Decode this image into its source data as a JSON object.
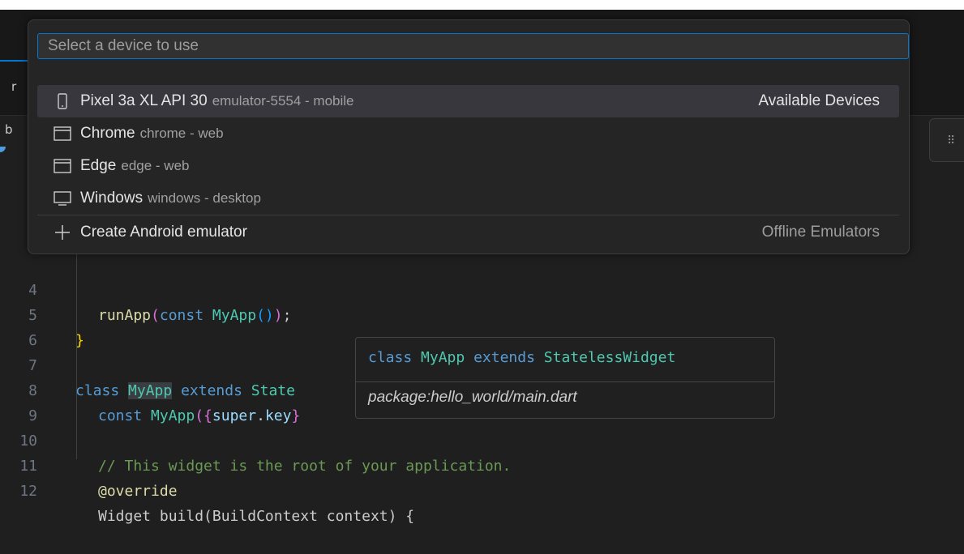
{
  "quick_pick": {
    "placeholder": "Select a device to use",
    "items": [
      {
        "icon": "phone-icon",
        "label": "Pixel 3a XL API 30",
        "description": "emulator-5554 - mobile",
        "group": "Available Devices",
        "selected": true
      },
      {
        "icon": "browser-window-icon",
        "label": "Chrome",
        "description": "chrome - web",
        "group": ""
      },
      {
        "icon": "browser-window-icon",
        "label": "Edge",
        "description": "edge - web",
        "group": ""
      },
      {
        "icon": "monitor-icon",
        "label": "Windows",
        "description": "windows - desktop",
        "group": ""
      },
      {
        "icon": "plus-icon",
        "label": "Create Android emulator",
        "description": "",
        "group": "Offline Emulators"
      }
    ]
  },
  "background_fragments": {
    "tab_fragment": "r",
    "breadcrumb_fragment": "b"
  },
  "editor": {
    "line_numbers": [
      "4",
      "5",
      "6",
      "7",
      "8",
      "9",
      "10",
      "11",
      "12"
    ],
    "lines": {
      "l4_fn": "runApp",
      "l4_open": "(",
      "l4_kw": "const",
      "l4_cls": "MyApp",
      "l4_parens": "()",
      "l4_close": ")",
      "l4_semi": ";",
      "l5": "}",
      "l7_kw1": "class",
      "l7_cls": "MyApp",
      "l7_kw2": "extends",
      "l7_cls2": "State",
      "l8_kw": "const",
      "l8_cls": "MyApp",
      "l8_open": "({",
      "l8_var": "super",
      "l8_dot": ".",
      "l8_key": "key",
      "l8_close": "}",
      "l10": "// This widget is the root of your application.",
      "l11": "@override",
      "l12": "Widget build(BuildContext context) {"
    }
  },
  "hover": {
    "sig_kw1": "class",
    "sig_cls": "MyApp",
    "sig_kw2": "extends",
    "sig_base": "StatelessWidget",
    "package": "package:hello_world/main.dart"
  },
  "colors": {
    "accent": "#0078d4",
    "selection": "#37373d",
    "background": "#1f1f1f"
  }
}
